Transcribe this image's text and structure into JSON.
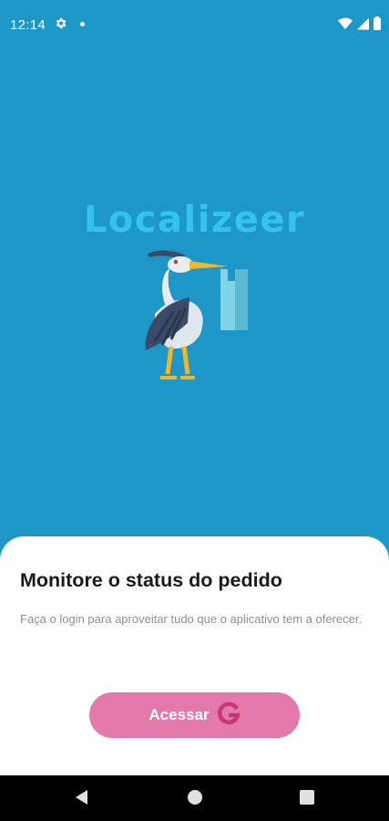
{
  "status_bar": {
    "time": "12:14",
    "icons": [
      "gear-icon",
      "notification-dot",
      "wifi-icon",
      "signal-icon",
      "battery-icon"
    ]
  },
  "splash": {
    "app_name": "Localizeer",
    "logo_icon": "heron-shopping-bag-icon"
  },
  "sheet": {
    "title": "Monitore o status do pedido",
    "subtitle": "Faça o login para aproveitar tudo que o aplicativo tem a oferecer.",
    "button_label": "Acessar",
    "button_icon": "google-g-icon"
  },
  "nav_bar": {
    "icons": [
      "back-icon",
      "home-icon",
      "recents-icon"
    ]
  },
  "colors": {
    "background": "#1d97c7",
    "logo_text": "#33c3ee",
    "button": "#e47aa9",
    "sheet": "#ffffff"
  }
}
